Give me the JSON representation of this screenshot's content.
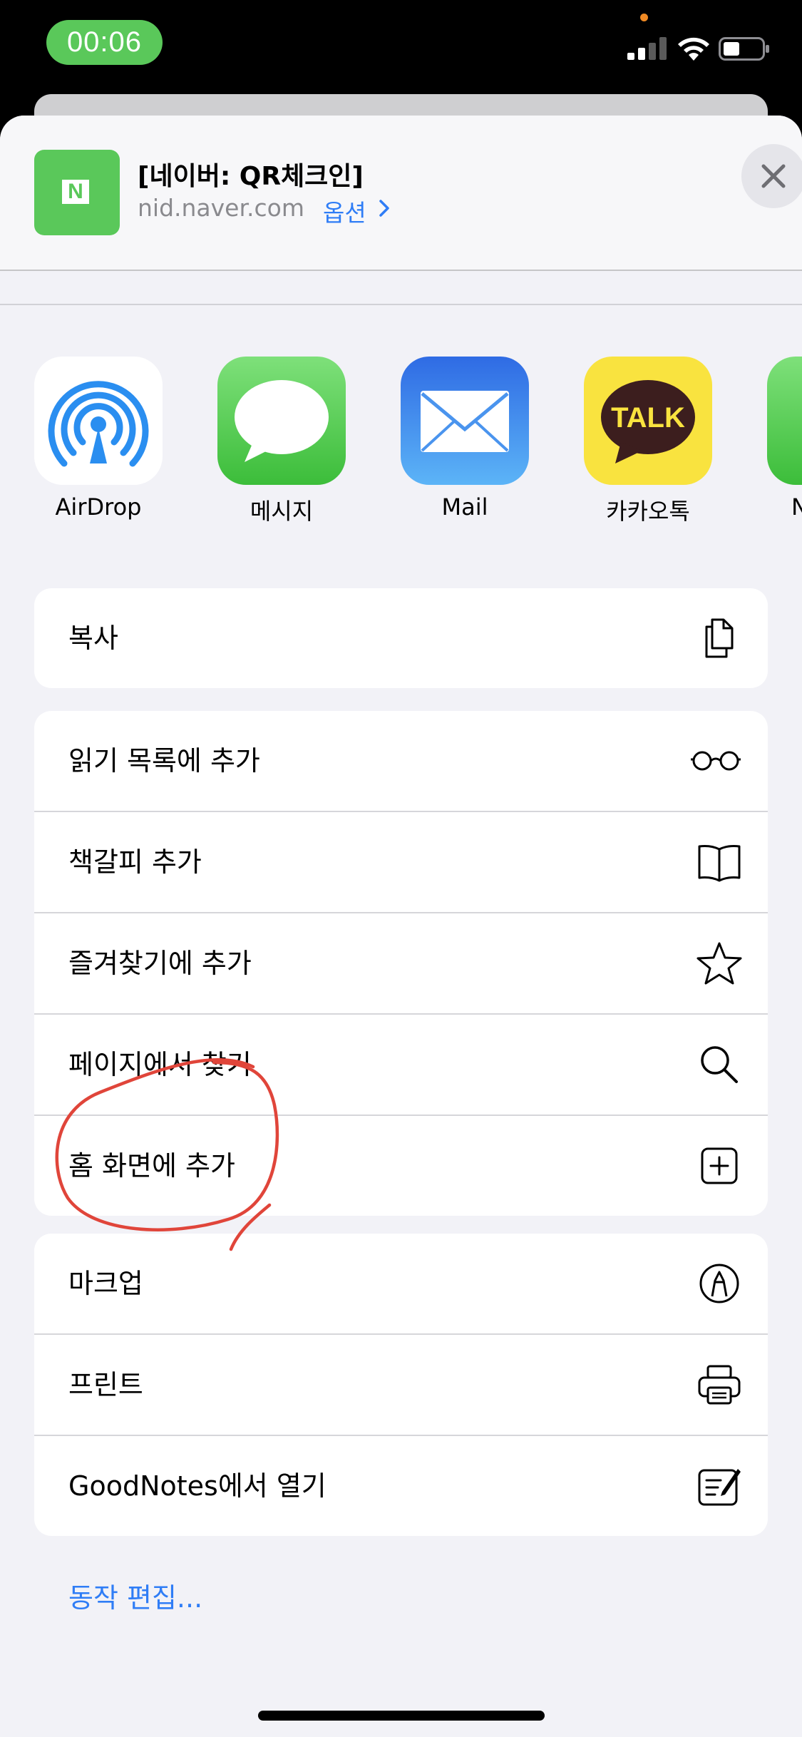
{
  "status_bar": {
    "time": "00:06"
  },
  "share_header": {
    "title": "[네이버: QR체크인]",
    "url": "nid.naver.com",
    "options_label": "옵션",
    "app_icon_letter": "N",
    "close_icon": "close-icon"
  },
  "apps": [
    {
      "label": "AirDrop",
      "icon": "airdrop-icon"
    },
    {
      "label": "메시지",
      "icon": "messages-icon"
    },
    {
      "label": "Mail",
      "icon": "mail-icon"
    },
    {
      "label": "카카오톡",
      "icon": "kakaotalk-icon",
      "icon_text": "TALK"
    },
    {
      "label": "N",
      "icon": "partial-app-icon"
    }
  ],
  "actions_group1": [
    {
      "label": "복사",
      "icon": "copy-icon"
    }
  ],
  "actions_group2": [
    {
      "label": "읽기 목록에 추가",
      "icon": "glasses-icon"
    },
    {
      "label": "책갈피 추가",
      "icon": "book-icon"
    },
    {
      "label": "즐겨찾기에 추가",
      "icon": "star-icon"
    },
    {
      "label": "페이지에서 찾기",
      "icon": "search-icon"
    },
    {
      "label": "홈 화면에 추가",
      "icon": "add-square-icon"
    }
  ],
  "actions_group3": [
    {
      "label": "마크업",
      "icon": "markup-icon"
    },
    {
      "label": "프린트",
      "icon": "printer-icon"
    },
    {
      "label": "GoodNotes에서 열기",
      "icon": "goodnotes-icon"
    }
  ],
  "edit_actions_label": "동작 편집...",
  "colors": {
    "accent": "#2f7df6",
    "naver_green": "#5ac85a",
    "annotation_red": "#e0453a"
  }
}
